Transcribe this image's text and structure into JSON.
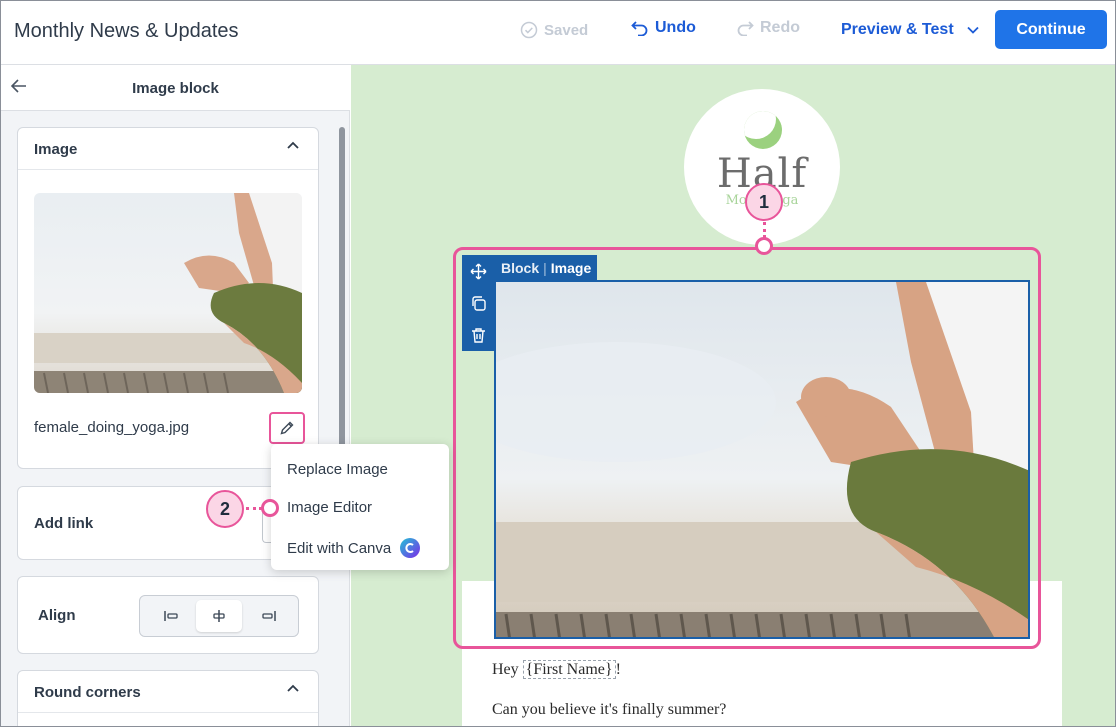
{
  "topbar": {
    "title": "Monthly News & Updates",
    "saved": "Saved",
    "undo": "Undo",
    "redo": "Redo",
    "preview": "Preview & Test",
    "continue": "Continue"
  },
  "panel": {
    "title": "Image block",
    "image_section": "Image",
    "filename": "female_doing_yoga.jpg",
    "add_link": "Add link",
    "align": "Align",
    "round_corners": "Round corners"
  },
  "menu": {
    "items": [
      "Replace Image",
      "Image Editor",
      "Edit with Canva"
    ]
  },
  "callouts": [
    "1",
    "2"
  ],
  "canvas": {
    "logo_main": "Half",
    "logo_sub": "Moon Yoga",
    "block_label": "Block",
    "block_type": "Image",
    "greeting_prefix": "Hey ",
    "greeting_tag": "{First Name}",
    "greeting_suffix": "!",
    "line2": "Can you believe it's finally summer?"
  },
  "colors": {
    "accent_blue": "#1f74e8",
    "link_blue": "#1c5bd6",
    "annotation_pink": "#e8559a",
    "canvas_green": "#d6ecd0",
    "block_blue": "#1a5fa8"
  },
  "icons": [
    "back-arrow-icon",
    "check-circle-icon",
    "undo-icon",
    "redo-icon",
    "chevron-down-icon",
    "chevron-up-icon",
    "pencil-icon",
    "align-left-icon",
    "align-center-icon",
    "align-right-icon",
    "canva-icon",
    "move-icon",
    "duplicate-icon",
    "trash-icon"
  ]
}
